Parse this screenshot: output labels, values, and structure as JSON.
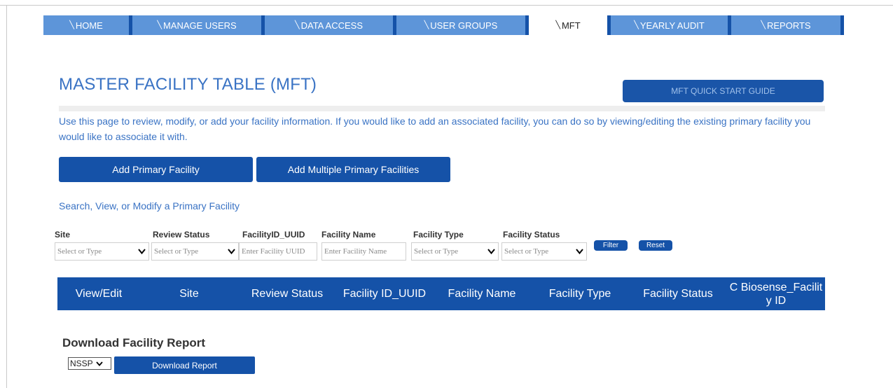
{
  "nav": {
    "tabs": [
      {
        "label": "HOME",
        "active": false
      },
      {
        "label": "MANAGE USERS",
        "active": false
      },
      {
        "label": "DATA ACCESS",
        "active": false
      },
      {
        "label": "USER GROUPS",
        "active": false
      },
      {
        "label": "MFT",
        "active": true
      },
      {
        "label": "YEARLY AUDIT",
        "active": false
      },
      {
        "label": "REPORTS",
        "active": false
      }
    ]
  },
  "page": {
    "title": "MASTER FACILITY TABLE (MFT)",
    "guide_button": "MFT QUICK START GUIDE",
    "intro": "Use this page to review, modify, or add your facility information. If you would like to add an associated facility, you can do so by viewing/editing the existing primary facility you would like to associate it with."
  },
  "actions": {
    "add_primary": "Add Primary Facility",
    "add_multiple": "Add Multiple Primary Facilities"
  },
  "search": {
    "link": "Search, View, or Modify a Primary Facility",
    "filters": [
      {
        "label": "Site",
        "placeholder": "Select or Type",
        "kind": "select"
      },
      {
        "label": "Review Status",
        "placeholder": "Select or Type",
        "kind": "select"
      },
      {
        "label": "FacilityID_UUID",
        "placeholder": "Enter Facility UUID",
        "kind": "input"
      },
      {
        "label": "Facility Name",
        "placeholder": "Enter Facility Name",
        "kind": "input"
      },
      {
        "label": "Facility Type",
        "placeholder": "Select or Type",
        "kind": "select"
      },
      {
        "label": "Facility Status",
        "placeholder": "Select or Type",
        "kind": "select"
      }
    ],
    "filter_button": "Filter",
    "reset_button": "Reset"
  },
  "table": {
    "columns": [
      "View/Edit",
      "Site",
      "Review Status",
      "Facility ID_UUID",
      "Facility Name",
      "Facility Type",
      "Facility Status",
      "C Biosense_Facility ID"
    ]
  },
  "download": {
    "title": "Download Facility Report",
    "selected": "NSSP",
    "button": "Download Report"
  },
  "colors": {
    "primary": "#1552a8",
    "tab": "#5d95d9",
    "link": "#3a73c4"
  }
}
